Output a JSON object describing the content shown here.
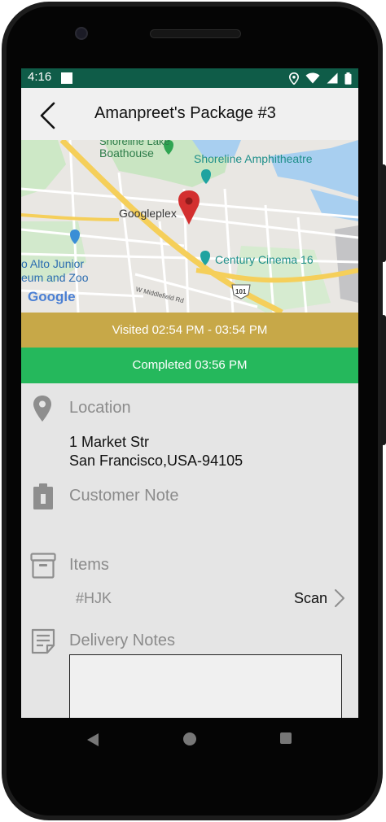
{
  "status_bar": {
    "time": "4:16",
    "icons": [
      "location-icon",
      "wifi-icon",
      "signal-icon",
      "battery-icon"
    ]
  },
  "app_bar": {
    "back_icon": "chevron-left-icon",
    "title": "Amanpreet's Package #3"
  },
  "map": {
    "labels": {
      "boathouse_line1": "Shoreline Lake",
      "boathouse_line2": "Boathouse",
      "amphitheatre": "Shoreline Amphitheatre",
      "googleplex": "Googleplex",
      "junior_line1": "o Alto Junior",
      "junior_line2": "eum and Zoo",
      "cinema": "Century Cinema 16",
      "road": "W Middlefield Rd",
      "highway": "101",
      "logo": "Google"
    }
  },
  "visit": {
    "visited": "Visited 02:54 PM - 03:54 PM",
    "completed": "Completed 03:56 PM"
  },
  "location": {
    "label": "Location",
    "line1": "1 Market Str",
    "line2": "San Francisco,USA-94105"
  },
  "customer_note": {
    "label": "Customer Note"
  },
  "items": {
    "label": "Items",
    "code": "#HJK",
    "scan_label": "Scan"
  },
  "delivery_notes": {
    "label": "Delivery Notes",
    "value": ""
  },
  "colors": {
    "status_bar": "#0f5c48",
    "visited": "#c7a848",
    "completed": "#25b85c",
    "pin": "#d32f2f"
  }
}
